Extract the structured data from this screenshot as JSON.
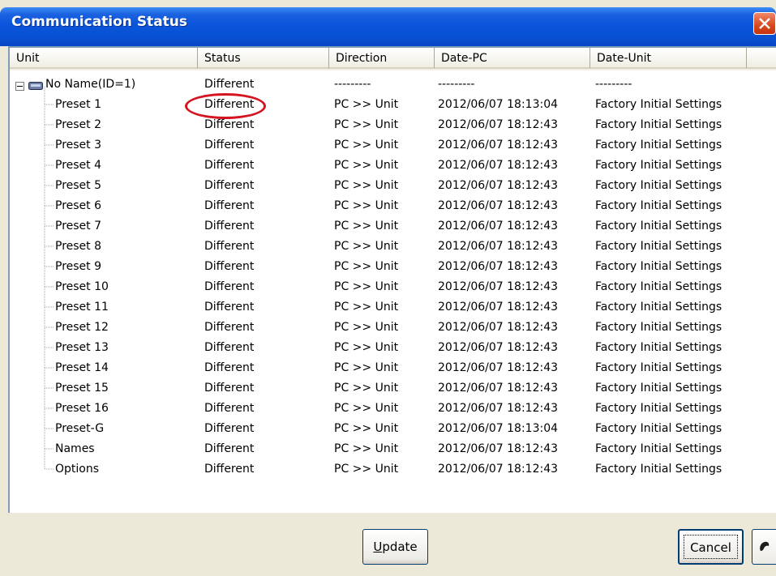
{
  "window": {
    "title": "Communication Status"
  },
  "columns": [
    "Unit",
    "Status",
    "Direction",
    "Date-PC",
    "Date-Unit"
  ],
  "root": {
    "label": "No Name(ID=1)",
    "status": "Different",
    "direction": "---------",
    "date_pc": "---------",
    "date_unit": "---------"
  },
  "rows": [
    {
      "unit": "Preset 1",
      "status": "Different",
      "direction": "PC >> Unit",
      "date_pc": "2012/06/07 18:13:04",
      "date_unit": "Factory Initial Settings"
    },
    {
      "unit": "Preset 2",
      "status": "Different",
      "direction": "PC >> Unit",
      "date_pc": "2012/06/07 18:12:43",
      "date_unit": "Factory Initial Settings"
    },
    {
      "unit": "Preset 3",
      "status": "Different",
      "direction": "PC >> Unit",
      "date_pc": "2012/06/07 18:12:43",
      "date_unit": "Factory Initial Settings"
    },
    {
      "unit": "Preset 4",
      "status": "Different",
      "direction": "PC >> Unit",
      "date_pc": "2012/06/07 18:12:43",
      "date_unit": "Factory Initial Settings"
    },
    {
      "unit": "Preset 5",
      "status": "Different",
      "direction": "PC >> Unit",
      "date_pc": "2012/06/07 18:12:43",
      "date_unit": "Factory Initial Settings"
    },
    {
      "unit": "Preset 6",
      "status": "Different",
      "direction": "PC >> Unit",
      "date_pc": "2012/06/07 18:12:43",
      "date_unit": "Factory Initial Settings"
    },
    {
      "unit": "Preset 7",
      "status": "Different",
      "direction": "PC >> Unit",
      "date_pc": "2012/06/07 18:12:43",
      "date_unit": "Factory Initial Settings"
    },
    {
      "unit": "Preset 8",
      "status": "Different",
      "direction": "PC >> Unit",
      "date_pc": "2012/06/07 18:12:43",
      "date_unit": "Factory Initial Settings"
    },
    {
      "unit": "Preset 9",
      "status": "Different",
      "direction": "PC >> Unit",
      "date_pc": "2012/06/07 18:12:43",
      "date_unit": "Factory Initial Settings"
    },
    {
      "unit": "Preset 10",
      "status": "Different",
      "direction": "PC >> Unit",
      "date_pc": "2012/06/07 18:12:43",
      "date_unit": "Factory Initial Settings"
    },
    {
      "unit": "Preset 11",
      "status": "Different",
      "direction": "PC >> Unit",
      "date_pc": "2012/06/07 18:12:43",
      "date_unit": "Factory Initial Settings"
    },
    {
      "unit": "Preset 12",
      "status": "Different",
      "direction": "PC >> Unit",
      "date_pc": "2012/06/07 18:12:43",
      "date_unit": "Factory Initial Settings"
    },
    {
      "unit": "Preset 13",
      "status": "Different",
      "direction": "PC >> Unit",
      "date_pc": "2012/06/07 18:12:43",
      "date_unit": "Factory Initial Settings"
    },
    {
      "unit": "Preset 14",
      "status": "Different",
      "direction": "PC >> Unit",
      "date_pc": "2012/06/07 18:12:43",
      "date_unit": "Factory Initial Settings"
    },
    {
      "unit": "Preset 15",
      "status": "Different",
      "direction": "PC >> Unit",
      "date_pc": "2012/06/07 18:12:43",
      "date_unit": "Factory Initial Settings"
    },
    {
      "unit": "Preset 16",
      "status": "Different",
      "direction": "PC >> Unit",
      "date_pc": "2012/06/07 18:12:43",
      "date_unit": "Factory Initial Settings"
    },
    {
      "unit": "Preset-G",
      "status": "Different",
      "direction": "PC >> Unit",
      "date_pc": "2012/06/07 18:13:04",
      "date_unit": "Factory Initial Settings"
    },
    {
      "unit": "Names",
      "status": "Different",
      "direction": "PC >> Unit",
      "date_pc": "2012/06/07 18:12:43",
      "date_unit": "Factory Initial Settings"
    },
    {
      "unit": "Options",
      "status": "Different",
      "direction": "PC >> Unit",
      "date_pc": "2012/06/07 18:12:43",
      "date_unit": "Factory Initial Settings"
    }
  ],
  "buttons": {
    "update_label": "Update",
    "update_mnemonic": "U",
    "cancel_label": "Cancel"
  },
  "annotation": {
    "highlight_color": "#d4151f"
  },
  "icons": {
    "close": "close-icon",
    "unit": "device-unit-icon",
    "expand": "tree-collapse-icon",
    "extra": "help-icon"
  }
}
